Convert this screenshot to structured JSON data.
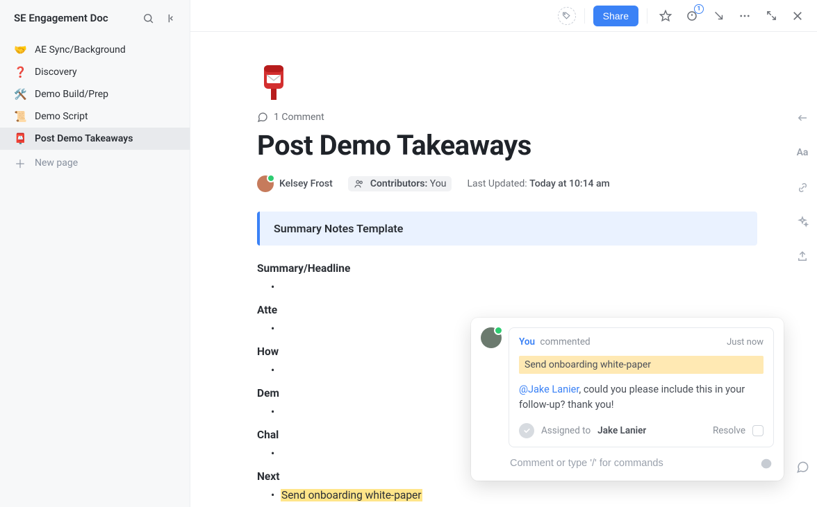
{
  "sidebar": {
    "title": "SE Engagement Doc",
    "items": [
      {
        "emoji": "🤝",
        "label": "AE Sync/Background"
      },
      {
        "emoji": "❓",
        "label": "Discovery"
      },
      {
        "emoji": "🛠️",
        "label": "Demo Build/Prep"
      },
      {
        "emoji": "📜",
        "label": "Demo Script"
      },
      {
        "emoji": "📮",
        "label": "Post Demo Takeaways"
      }
    ],
    "new_page": "New page"
  },
  "topbar": {
    "share": "Share",
    "bell_badge": "1"
  },
  "doc": {
    "comment_count": "1 Comment",
    "title": "Post Demo Takeaways",
    "owner": "Kelsey Frost",
    "contributors_label": "Contributors:",
    "contributors_value": "You",
    "last_updated_label": "Last Updated:",
    "last_updated_value": "Today at 10:14 am",
    "callout": "Summary Notes Template",
    "sections": {
      "s1": "Summary/Headline",
      "s2": "Atte",
      "s3": "How",
      "s4": "Dem",
      "s5": "Chal",
      "s6": "Next",
      "next_item": "Send onboarding white-paper"
    }
  },
  "comment": {
    "author": "You",
    "action": "commented",
    "time": "Just now",
    "quote": "Send onboarding white-paper",
    "mention": "@Jake Lanier",
    "message_rest": ", could you please include this in your follow-up? thank you!",
    "assigned_label": "Assigned to",
    "assignee": "Jake Lanier",
    "resolve": "Resolve",
    "compose_placeholder": "Comment or type '/' for commands"
  },
  "rail": {
    "aa": "Aa"
  }
}
